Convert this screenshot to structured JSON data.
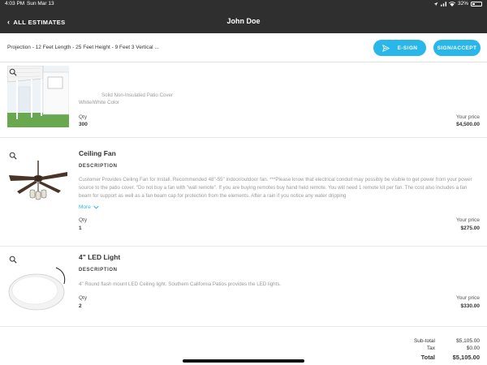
{
  "status_bar": {
    "time": "4:03 PM",
    "date": "Sun Mar 13",
    "battery": "32%"
  },
  "header": {
    "back_label": "ALL ESTIMATES",
    "title": "John Doe"
  },
  "subheader": {
    "project": "Projection - 12 Feet Length - 25 Feet Height - 9 Feet 3 Vertical ...",
    "esign_label": "E-SIGN",
    "sign_accept_label": "SIGN/ACCEPT"
  },
  "items": [
    {
      "description_lines": [
        "Solid Non-Insulated Patio Cover",
        "White/White Color"
      ],
      "qty_label": "Qty",
      "qty": "300",
      "price_label": "Your price",
      "price": "$4,500.00"
    },
    {
      "name": "Ceiling Fan",
      "description_label": "DESCRIPTION",
      "description": "Customer Provides Ceiling Fan for Install. Recommended 48\"-55\" indoor/outdoor fan. ***Please know that electrical conduit may possibly be visible to get power from your power source to the patio cover. \"Do not buy a fan with \"wall remote\". If you are buying remotes buy hand held remote. You will need 1 remote kit per fan. The cost also includes a fan beam for support as well as a fan beam cap for protection from the elements. After a rain if you notice any water dripping",
      "more_label": "More",
      "qty_label": "Qty",
      "qty": "1",
      "price_label": "Your price",
      "price": "$275.00"
    },
    {
      "name": "4\" LED Light",
      "description_label": "DESCRIPTION",
      "description": "4\" Round flash mount LED Ceiling light. Southern California Patios provides the LED lights.",
      "qty_label": "Qty",
      "qty": "2",
      "price_label": "Your price",
      "price": "$330.00"
    }
  ],
  "totals": {
    "subtotal_label": "Sub-total",
    "subtotal": "$5,105.00",
    "tax_label": "Tax",
    "tax": "$0.00",
    "total_label": "Total",
    "total": "$5,105.00"
  },
  "colors": {
    "header_bg": "#2f2f2f",
    "accent": "#29b6e8"
  }
}
